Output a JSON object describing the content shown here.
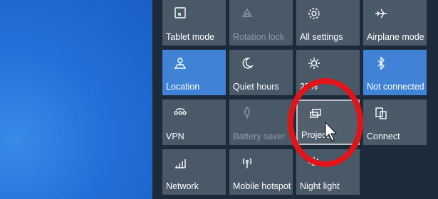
{
  "tiles": [
    {
      "label": "Tablet mode",
      "icon": "tablet-mode-icon",
      "state": "normal"
    },
    {
      "label": "Rotation lock",
      "icon": "rotation-lock-icon",
      "state": "disabled"
    },
    {
      "label": "All settings",
      "icon": "gear-icon",
      "state": "normal"
    },
    {
      "label": "Airplane mode",
      "icon": "airplane-icon",
      "state": "normal"
    },
    {
      "label": "Location",
      "icon": "location-icon",
      "state": "active"
    },
    {
      "label": "Quiet hours",
      "icon": "moon-icon",
      "state": "normal"
    },
    {
      "label": "25%",
      "icon": "brightness-icon",
      "state": "normal"
    },
    {
      "label": "Not connected",
      "icon": "bluetooth-icon",
      "state": "active"
    },
    {
      "label": "VPN",
      "icon": "vpn-icon",
      "state": "normal"
    },
    {
      "label": "Battery saver",
      "icon": "battery-saver-icon",
      "state": "disabled"
    },
    {
      "label": "Project",
      "icon": "project-icon",
      "state": "selected"
    },
    {
      "label": "Connect",
      "icon": "connect-icon",
      "state": "normal"
    },
    {
      "label": "Network",
      "icon": "network-icon",
      "state": "normal"
    },
    {
      "label": "Mobile hotspot",
      "icon": "mobile-hotspot-icon",
      "state": "normal"
    },
    {
      "label": "Night light",
      "icon": "night-light-icon",
      "state": "normal"
    }
  ],
  "colors": {
    "tile": "#4a5968",
    "tile_active": "#3f82d6",
    "annotation": "#e1141a",
    "panel": "#1d2a3a"
  }
}
